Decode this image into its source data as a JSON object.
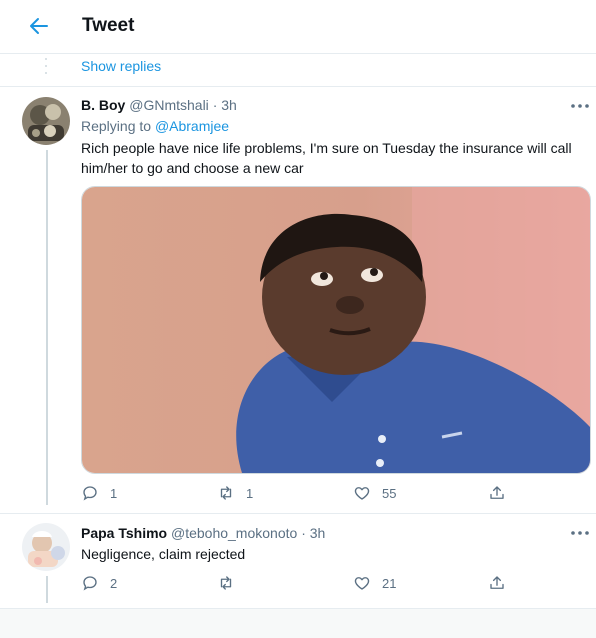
{
  "header": {
    "title": "Tweet"
  },
  "show_replies": "Show replies",
  "tweets": [
    {
      "name": "B. Boy",
      "handle": "@GNmtshali",
      "dot": "·",
      "time": "3h",
      "replying_prefix": "Replying to",
      "replying_to": "@Abramjee",
      "text": "Rich people have nice life problems, I'm sure on Tuesday the insurance will call him/her to go and  choose a new car",
      "replies": "1",
      "retweets": "1",
      "likes": "55"
    },
    {
      "name": "Papa Tshimo",
      "handle": "@teboho_mokonoto",
      "dot": "·",
      "time": "3h",
      "text": "Negligence, claim rejected",
      "replies": "2",
      "retweets": "",
      "likes": "21"
    }
  ],
  "colors": {
    "accent": "#1b95e0",
    "secondary_text": "#5b7083",
    "border": "#e6ecf0"
  },
  "icons": [
    "back-arrow-icon",
    "more-icon",
    "reply-icon",
    "retweet-icon",
    "like-icon",
    "share-icon"
  ]
}
